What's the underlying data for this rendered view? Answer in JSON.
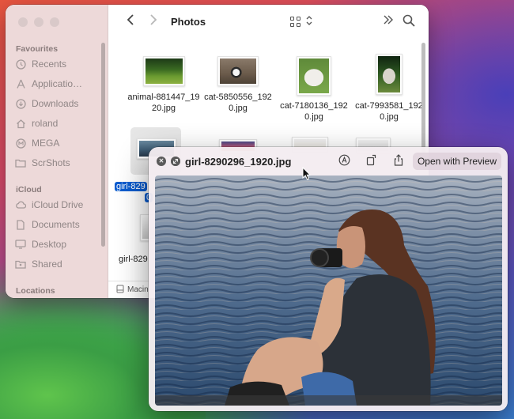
{
  "finder": {
    "title": "Photos",
    "sidebar": {
      "favourites_label": "Favourites",
      "favourites": [
        {
          "label": "Recents",
          "icon": "clock-icon"
        },
        {
          "label": "Applicatio…",
          "icon": "applications-icon"
        },
        {
          "label": "Downloads",
          "icon": "download-icon"
        },
        {
          "label": "roland",
          "icon": "home-icon"
        },
        {
          "label": "MEGA",
          "icon": "mega-icon"
        },
        {
          "label": "ScrShots",
          "icon": "folder-icon"
        }
      ],
      "icloud_label": "iCloud",
      "icloud": [
        {
          "label": "iCloud Drive",
          "icon": "cloud-icon"
        },
        {
          "label": "Documents",
          "icon": "document-icon"
        },
        {
          "label": "Desktop",
          "icon": "desktop-icon"
        },
        {
          "label": "Shared",
          "icon": "shared-folder-icon"
        }
      ],
      "locations_label": "Locations"
    },
    "files": [
      {
        "name_line1": "animal-881447_19",
        "name_line2": "20.jpg"
      },
      {
        "name_line1": "cat-5850556_192",
        "name_line2": "0.jpg"
      },
      {
        "name_line1": "cat-7180136_192",
        "name_line2": "0.jpg"
      },
      {
        "name_line1": "cat-7993581_192",
        "name_line2": "0.jpg"
      }
    ],
    "selected_file_line1": "girl-829",
    "selected_file_line2": "0",
    "partial_file_label": "girl-829",
    "path_bar_label": "Macin"
  },
  "quicklook": {
    "title": "girl-8290296_1920.jpg",
    "open_button": "Open with Preview"
  },
  "colors": {
    "selection": "#0a5ccf",
    "sidebar": "#ecd6d6"
  }
}
